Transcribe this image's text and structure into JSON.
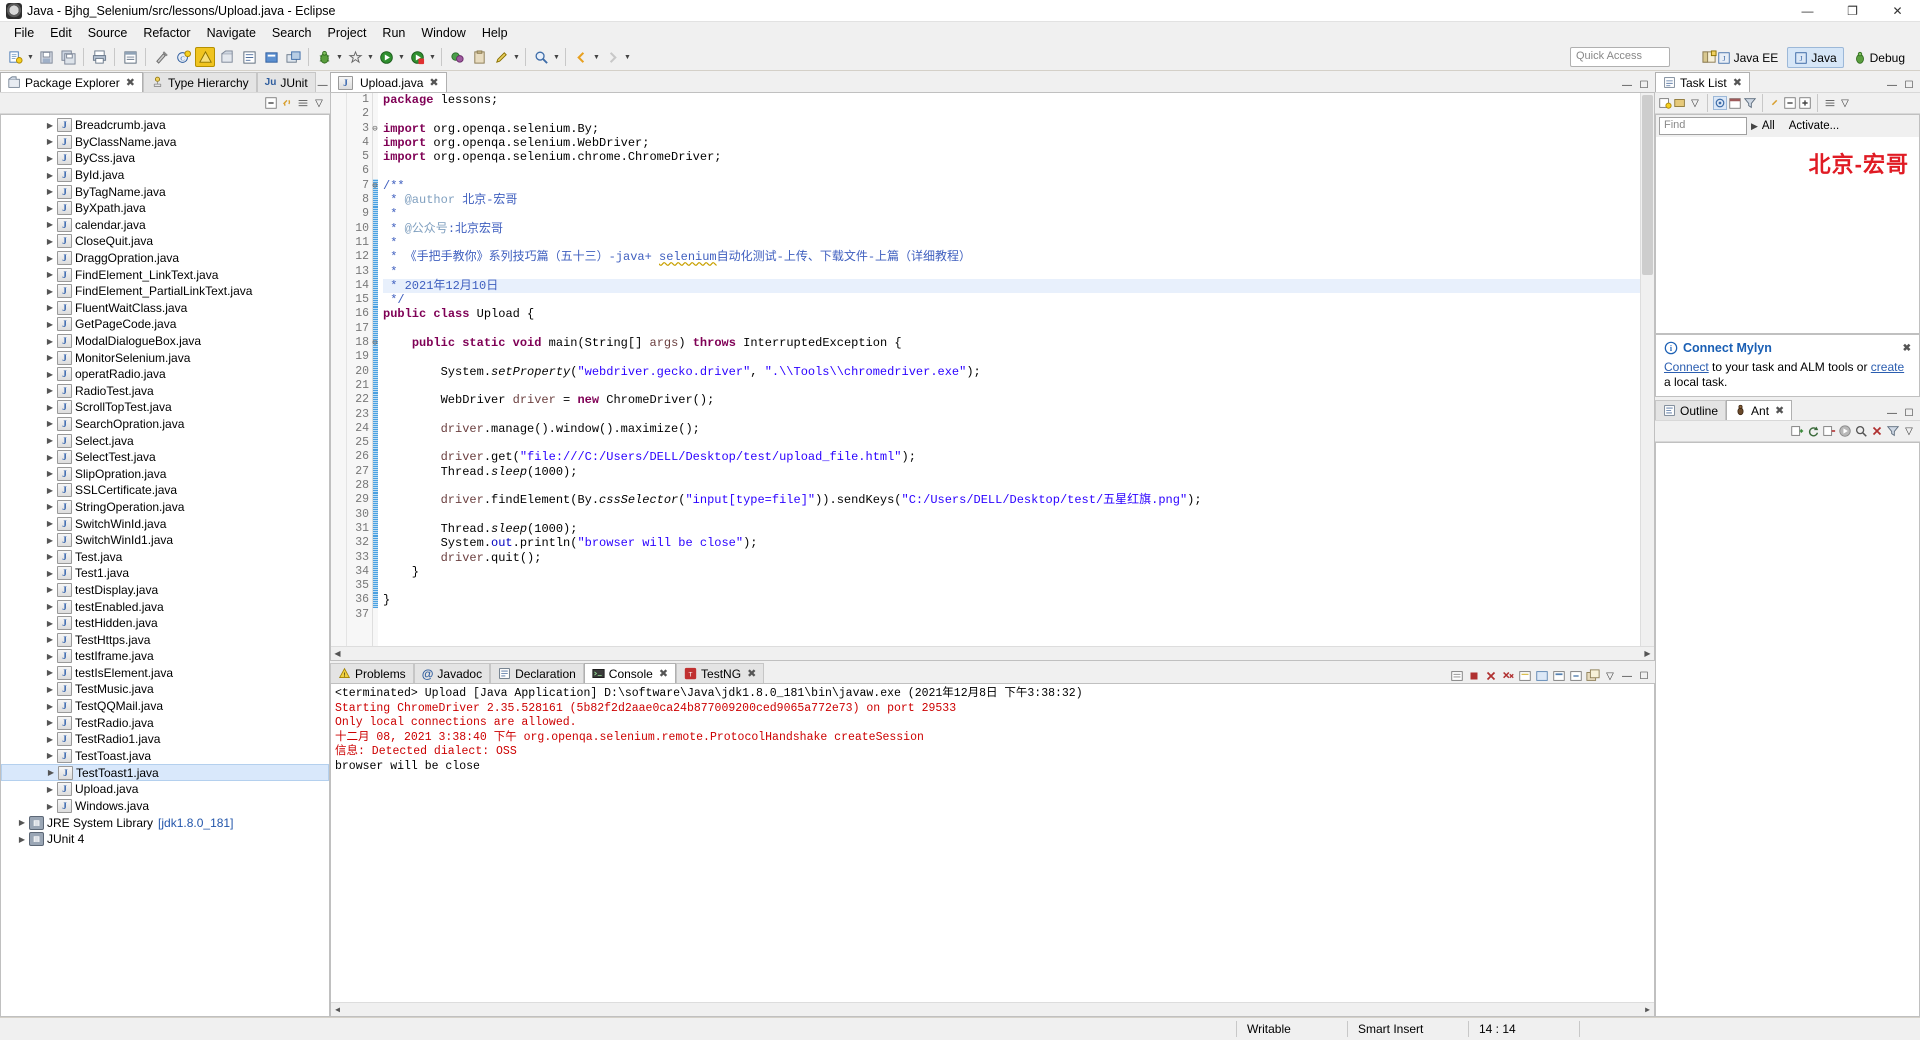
{
  "window": {
    "title": "Java - Bjhg_Selenium/src/lessons/Upload.java - Eclipse",
    "minimize": "—",
    "maximize": "❐",
    "close": "✕"
  },
  "menubar": {
    "items": [
      "File",
      "Edit",
      "Source",
      "Refactor",
      "Navigate",
      "Search",
      "Project",
      "Run",
      "Window",
      "Help"
    ]
  },
  "toolbar": {
    "quick_access_placeholder": "Quick Access",
    "perspectives": [
      {
        "label": "Java EE",
        "active": false
      },
      {
        "label": "Java",
        "active": true
      },
      {
        "label": "Debug",
        "active": false
      }
    ]
  },
  "package_explorer": {
    "tabs": [
      {
        "label": "Package Explorer",
        "active": true,
        "closable": true
      },
      {
        "label": "Type Hierarchy",
        "active": false,
        "closable": false
      },
      {
        "label": "JUnit",
        "active": false,
        "closable": false,
        "prefix": "Ju"
      }
    ],
    "items": [
      {
        "label": "Breadcrumb.java",
        "icon": "java-file",
        "indent": 3,
        "arrow": true
      },
      {
        "label": "ByClassName.java",
        "icon": "java-file",
        "indent": 3,
        "arrow": true
      },
      {
        "label": "ByCss.java",
        "icon": "java-file",
        "indent": 3,
        "arrow": true
      },
      {
        "label": "ById.java",
        "icon": "java-file",
        "indent": 3,
        "arrow": true
      },
      {
        "label": "ByTagName.java",
        "icon": "java-file",
        "indent": 3,
        "arrow": true
      },
      {
        "label": "ByXpath.java",
        "icon": "java-file",
        "indent": 3,
        "arrow": true
      },
      {
        "label": "calendar.java",
        "icon": "java-file",
        "indent": 3,
        "arrow": true
      },
      {
        "label": "CloseQuit.java",
        "icon": "java-file",
        "indent": 3,
        "arrow": true
      },
      {
        "label": "DraggOpration.java",
        "icon": "java-file",
        "indent": 3,
        "arrow": true
      },
      {
        "label": "FindElement_LinkText.java",
        "icon": "java-file",
        "indent": 3,
        "arrow": true
      },
      {
        "label": "FindElement_PartialLinkText.java",
        "icon": "java-file",
        "indent": 3,
        "arrow": true
      },
      {
        "label": "FluentWaitClass.java",
        "icon": "java-file",
        "indent": 3,
        "arrow": true
      },
      {
        "label": "GetPageCode.java",
        "icon": "java-file",
        "indent": 3,
        "arrow": true
      },
      {
        "label": "ModalDialogueBox.java",
        "icon": "java-file",
        "indent": 3,
        "arrow": true
      },
      {
        "label": "MonitorSelenium.java",
        "icon": "java-file",
        "indent": 3,
        "arrow": true
      },
      {
        "label": "operatRadio.java",
        "icon": "java-file",
        "indent": 3,
        "arrow": true
      },
      {
        "label": "RadioTest.java",
        "icon": "java-file",
        "indent": 3,
        "arrow": true
      },
      {
        "label": "ScrollTopTest.java",
        "icon": "java-file",
        "indent": 3,
        "arrow": true
      },
      {
        "label": "SearchOpration.java",
        "icon": "java-file",
        "indent": 3,
        "arrow": true
      },
      {
        "label": "Select.java",
        "icon": "java-file",
        "indent": 3,
        "arrow": true
      },
      {
        "label": "SelectTest.java",
        "icon": "java-file",
        "indent": 3,
        "arrow": true
      },
      {
        "label": "SlipOpration.java",
        "icon": "java-file",
        "indent": 3,
        "arrow": true
      },
      {
        "label": "SSLCertificate.java",
        "icon": "java-file",
        "indent": 3,
        "arrow": true
      },
      {
        "label": "StringOperation.java",
        "icon": "java-file",
        "indent": 3,
        "arrow": true
      },
      {
        "label": "SwitchWinId.java",
        "icon": "java-file",
        "indent": 3,
        "arrow": true
      },
      {
        "label": "SwitchWinId1.java",
        "icon": "java-file",
        "indent": 3,
        "arrow": true
      },
      {
        "label": "Test.java",
        "icon": "java-file",
        "indent": 3,
        "arrow": true
      },
      {
        "label": "Test1.java",
        "icon": "java-file",
        "indent": 3,
        "arrow": true
      },
      {
        "label": "testDisplay.java",
        "icon": "java-file",
        "indent": 3,
        "arrow": true
      },
      {
        "label": "testEnabled.java",
        "icon": "java-file",
        "indent": 3,
        "arrow": true
      },
      {
        "label": "testHidden.java",
        "icon": "java-file",
        "indent": 3,
        "arrow": true
      },
      {
        "label": "TestHttps.java",
        "icon": "java-file",
        "indent": 3,
        "arrow": true
      },
      {
        "label": "testIframe.java",
        "icon": "java-file",
        "indent": 3,
        "arrow": true
      },
      {
        "label": "testIsElement.java",
        "icon": "java-file",
        "indent": 3,
        "arrow": true
      },
      {
        "label": "TestMusic.java",
        "icon": "java-file",
        "indent": 3,
        "arrow": true
      },
      {
        "label": "TestQQMail.java",
        "icon": "java-file",
        "indent": 3,
        "arrow": true
      },
      {
        "label": "TestRadio.java",
        "icon": "java-file",
        "indent": 3,
        "arrow": true
      },
      {
        "label": "TestRadio1.java",
        "icon": "java-file",
        "indent": 3,
        "arrow": true
      },
      {
        "label": "TestToast.java",
        "icon": "java-file",
        "indent": 3,
        "arrow": true
      },
      {
        "label": "TestToast1.java",
        "icon": "java-file",
        "indent": 3,
        "arrow": true,
        "selected": true
      },
      {
        "label": "Upload.java",
        "icon": "java-file",
        "indent": 3,
        "arrow": true
      },
      {
        "label": "Windows.java",
        "icon": "java-file",
        "indent": 3,
        "arrow": true
      },
      {
        "label": "JRE System Library",
        "sub": "[jdk1.8.0_181]",
        "icon": "library",
        "indent": 1,
        "arrow": true
      },
      {
        "label": "JUnit 4",
        "icon": "library",
        "indent": 1,
        "arrow": true
      }
    ]
  },
  "editor": {
    "tab": {
      "label": "Upload.java",
      "icon": "java-file",
      "active": true
    },
    "lines": [
      {
        "n": 1,
        "fold": "",
        "html": "<span class=\"kw\">package</span> lessons;"
      },
      {
        "n": 2,
        "fold": "",
        "html": ""
      },
      {
        "n": 3,
        "fold": "⊖",
        "html": "<span class=\"kw\">import</span> org.openqa.selenium.By;"
      },
      {
        "n": 4,
        "fold": "",
        "html": "<span class=\"kw\">import</span> org.openqa.selenium.WebDriver;"
      },
      {
        "n": 5,
        "fold": "",
        "html": "<span class=\"kw\">import</span> org.openqa.selenium.chrome.ChromeDriver;"
      },
      {
        "n": 6,
        "fold": "",
        "html": ""
      },
      {
        "n": 7,
        "fold": "⊖",
        "html": "<span class=\"jdoc\">/**</span>"
      },
      {
        "n": 8,
        "fold": "",
        "html": "<span class=\"jdoc\"> * </span><span class=\"jtag\">@author</span><span class=\"jdoc\"> 北京-宏哥</span>"
      },
      {
        "n": 9,
        "fold": "",
        "html": "<span class=\"jdoc\"> * </span>"
      },
      {
        "n": 10,
        "fold": "",
        "html": "<span class=\"jdoc\"> * </span><span class=\"jtag\">@公众号</span><span class=\"jdoc\">:北京宏哥</span>"
      },
      {
        "n": 11,
        "fold": "",
        "html": "<span class=\"jdoc\"> * </span>"
      },
      {
        "n": 12,
        "fold": "",
        "html": "<span class=\"jdoc\"> * 《手把手教你》系列技巧篇（五十三）-java+ </span><span class=\"jdoc squiggle\">selenium</span><span class=\"jdoc\">自动化测试-上传、下载文件-上篇（详细教程）</span>"
      },
      {
        "n": 13,
        "fold": "",
        "html": "<span class=\"jdoc\"> * </span>"
      },
      {
        "n": 14,
        "fold": "",
        "html": "<span class=\"jdoc\"> * 2021年12月10日</span>",
        "hl": true
      },
      {
        "n": 15,
        "fold": "",
        "html": "<span class=\"jdoc\"> */</span>"
      },
      {
        "n": 16,
        "fold": "",
        "html": "<span class=\"kw\">public</span> <span class=\"kw\">class</span> Upload {"
      },
      {
        "n": 17,
        "fold": "",
        "html": ""
      },
      {
        "n": 18,
        "fold": "⊖",
        "html": "    <span class=\"kw\">public</span> <span class=\"kw\">static</span> <span class=\"kw\">void</span> main(String[] <span class=\"loc\">args</span>) <span class=\"kw\">throws</span> InterruptedException {"
      },
      {
        "n": 19,
        "fold": "",
        "html": ""
      },
      {
        "n": 20,
        "fold": "",
        "html": "        System.<span class=\"stat\">setProperty</span>(<span class=\"str\">\"webdriver.gecko.driver\"</span>, <span class=\"str\">\".\\\\Tools\\\\chromedriver.exe\"</span>);"
      },
      {
        "n": 21,
        "fold": "",
        "html": ""
      },
      {
        "n": 22,
        "fold": "",
        "html": "        WebDriver <span class=\"loc\">driver</span> = <span class=\"kw\">new</span> ChromeDriver();"
      },
      {
        "n": 23,
        "fold": "",
        "html": ""
      },
      {
        "n": 24,
        "fold": "",
        "html": "        <span class=\"loc\">driver</span>.manage().window().maximize();"
      },
      {
        "n": 25,
        "fold": "",
        "html": ""
      },
      {
        "n": 26,
        "fold": "",
        "html": "        <span class=\"loc\">driver</span>.get(<span class=\"str\">\"file:///C:/Users/DELL/Desktop/test/upload_file.html\"</span>);"
      },
      {
        "n": 27,
        "fold": "",
        "html": "        Thread.<span class=\"stat\">sleep</span>(1000);"
      },
      {
        "n": 28,
        "fold": "",
        "html": ""
      },
      {
        "n": 29,
        "fold": "",
        "html": "        <span class=\"loc\">driver</span>.findElement(By.<span class=\"stat\">cssSelector</span>(<span class=\"str\">\"input[type=file]\"</span>)).sendKeys(<span class=\"str\">\"C:/Users/DELL/Desktop/test/五星红旗.png\"</span>);"
      },
      {
        "n": 30,
        "fold": "",
        "html": ""
      },
      {
        "n": 31,
        "fold": "",
        "html": "        Thread.<span class=\"stat\">sleep</span>(1000);"
      },
      {
        "n": 32,
        "fold": "",
        "html": "        System.<span class=\"fld\">out</span>.println(<span class=\"str\">\"browser will be close\"</span>);"
      },
      {
        "n": 33,
        "fold": "",
        "html": "        <span class=\"loc\">driver</span>.quit();"
      },
      {
        "n": 34,
        "fold": "",
        "html": "    }"
      },
      {
        "n": 35,
        "fold": "",
        "html": ""
      },
      {
        "n": 36,
        "fold": "",
        "html": "}"
      },
      {
        "n": 37,
        "fold": "",
        "html": ""
      }
    ]
  },
  "bottom_panel": {
    "tabs": [
      {
        "label": "Problems",
        "active": false,
        "icon": "problems-icon"
      },
      {
        "label": "Javadoc",
        "active": false,
        "icon": "javadoc-icon"
      },
      {
        "label": "Declaration",
        "active": false,
        "icon": "declaration-icon"
      },
      {
        "label": "Console",
        "active": true,
        "icon": "console-icon",
        "closable": true
      },
      {
        "label": "TestNG",
        "active": false,
        "icon": "testng-icon",
        "closable": true
      }
    ],
    "header": "<terminated> Upload [Java Application] D:\\software\\Java\\jdk1.8.0_181\\bin\\javaw.exe (2021年12月8日 下午3:38:32)",
    "lines": [
      {
        "text": "Starting ChromeDriver 2.35.528161 (5b82f2d2aae0ca24b877009200ced9065a772e73) on port 29533",
        "color": "red"
      },
      {
        "text": "Only local connections are allowed.",
        "color": "red"
      },
      {
        "text": "十二月 08, 2021 3:38:40 下午 org.openqa.selenium.remote.ProtocolHandshake createSession",
        "color": "red"
      },
      {
        "text": "信息: Detected dialect: OSS",
        "color": "red"
      },
      {
        "text": "browser will be close",
        "color": "black"
      }
    ]
  },
  "task_list": {
    "tabs": [
      {
        "label": "Task List",
        "active": true,
        "closable": true
      }
    ],
    "find_placeholder": "Find",
    "all_label": "All",
    "activate_label": "Activate...",
    "watermark": "北京-宏哥"
  },
  "mylyn": {
    "title": "Connect Mylyn",
    "link_connect": "Connect",
    "text_mid": " to your task and ALM tools or ",
    "link_create": "create",
    "text_end": "a local task."
  },
  "outline": {
    "tabs": [
      {
        "label": "Outline",
        "active": false
      },
      {
        "label": "Ant",
        "active": true,
        "closable": true
      }
    ]
  },
  "statusbar": {
    "writable": "Writable",
    "insert_mode": "Smart Insert",
    "position": "14 : 14"
  }
}
